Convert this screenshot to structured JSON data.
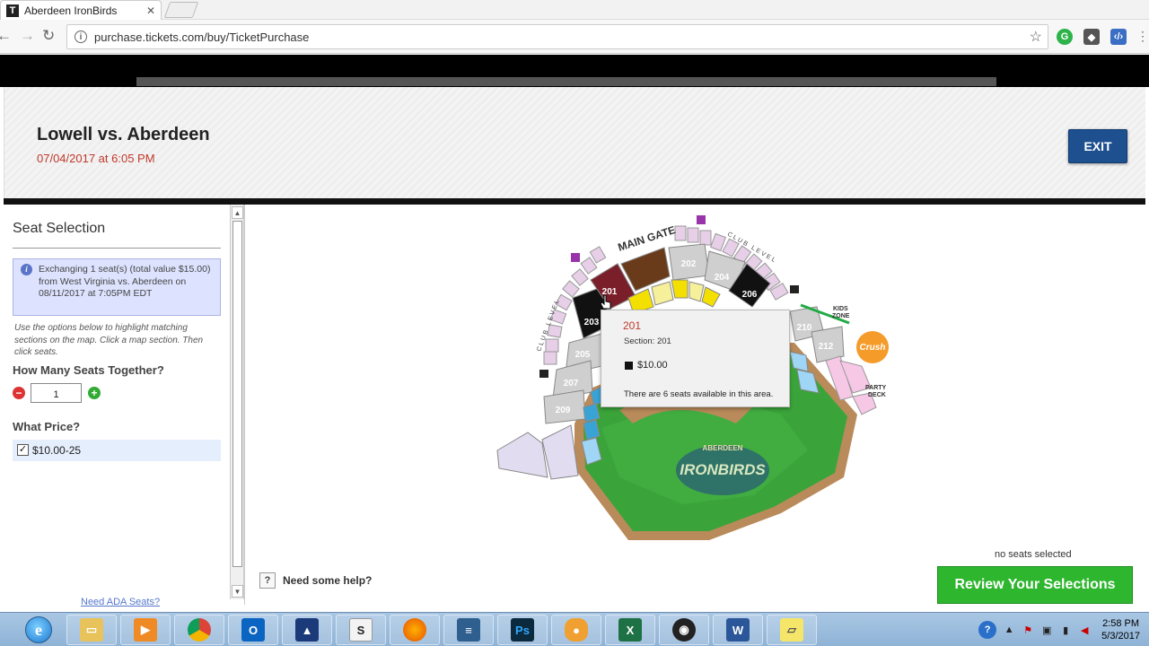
{
  "browser": {
    "tab_title": "Aberdeen IronBirds",
    "tab_favicon": "T",
    "url": "purchase.tickets.com/buy/TicketPurchase"
  },
  "header": {
    "event_title": "Lowell vs. Aberdeen",
    "event_date": "07/04/2017 at 6:05 PM",
    "exit_label": "EXIT"
  },
  "left_panel": {
    "title": "Seat Selection",
    "exchange_note": "Exchanging 1 seat(s) (total value $15.00) from West Virginia vs. Aberdeen on 08/11/2017 at 7:05PM EDT",
    "instructions": "Use the options below to highlight matching sections on the map. Click a map section. Then click seats.",
    "seats_question": "How Many Seats Together?",
    "seats_value": "1",
    "price_question": "What Price?",
    "price_option": "$10.00-25",
    "price_checked": true,
    "ada_link": "Need ADA Seats?"
  },
  "map": {
    "main_gate": "MAIN GATE",
    "club_level": "CLUB LEVEL",
    "kids_zone": [
      "KIDS",
      "ZONE"
    ],
    "party_deck": [
      "PARTY",
      "DECK"
    ],
    "crush_zone": "Crush",
    "team_logo": "IRONBIRDS",
    "team_logo_top": "ABERDEEN",
    "sections": [
      "201",
      "202",
      "203",
      "204",
      "205",
      "206",
      "207",
      "209",
      "210",
      "212"
    ]
  },
  "tooltip": {
    "title": "201",
    "section": "Section: 201",
    "price": "$10.00",
    "availability": "There are 6 seats available in this area."
  },
  "footer": {
    "help": "Need some help?",
    "no_seats": "no seats selected",
    "review_button": "Review Your Selections"
  },
  "taskbar": {
    "time": "2:58 PM",
    "date": "5/3/2017",
    "apps": [
      "internet-explorer",
      "file-explorer",
      "media-player",
      "chrome",
      "outlook",
      "app-blue",
      "slides",
      "firefox",
      "notes",
      "photoshop",
      "chat",
      "excel",
      "obs",
      "word",
      "sticky-notes"
    ]
  },
  "colors": {
    "exit_blue": "#1e4f8f",
    "review_green": "#2fb62f",
    "date_red": "#c0392b",
    "field_green": "#3aa43a",
    "selected_section": "#7a1f2a"
  }
}
